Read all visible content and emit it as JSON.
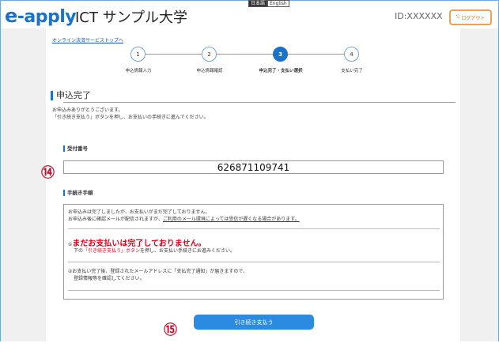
{
  "header": {
    "logo_e": "e",
    "logo_rest": "-apply",
    "university": "ICT サンプル大学",
    "lang_ja": "日本語",
    "lang_en": "English",
    "user_id": "ID:XXXXXX",
    "logout_label": "ログアウト"
  },
  "shop_link": "オンライン決済サービストップへ",
  "steps": [
    {
      "num": "1",
      "label": "申込情報入力"
    },
    {
      "num": "2",
      "label": "申込情報確認"
    },
    {
      "num": "3",
      "label": "申込完了・支払い選択"
    },
    {
      "num": "4",
      "label": "支払い完了"
    }
  ],
  "page_title": "申込完了",
  "intro": {
    "line1": "お申込みありがとうございます。",
    "line2": "「引き続き支払う」ボタンを押し、お支払いの手続きに進んでください。"
  },
  "receipt": {
    "heading": "受付番号",
    "number": "626871109741",
    "marker": "⑭"
  },
  "procedure": {
    "heading": "手続き手順",
    "line1": "お申込みは完了しましたが、お支払いがまだ完了しておりません。",
    "line2a": "お申込み後に確認メールが配信されますが、",
    "line2b": "ご利用のメール環境によっては受信が遅くなる場合があります。",
    "warn_prefix": "①",
    "warn_big": "まだお支払いは完了しておりません。",
    "warn2_a": "下の",
    "warn2_b": "「引き続き支払う」ボタン",
    "warn2_c": "を押し、お支払い手続きにお進みください。",
    "step2_line1": "②お支払い完了後、登録されたメールアドレスに「支払完了通知」が届きますので、",
    "step2_line2": "登録情報等を確認してください。"
  },
  "continue_button": {
    "label": "引き続き支払う",
    "marker": "⑮"
  }
}
